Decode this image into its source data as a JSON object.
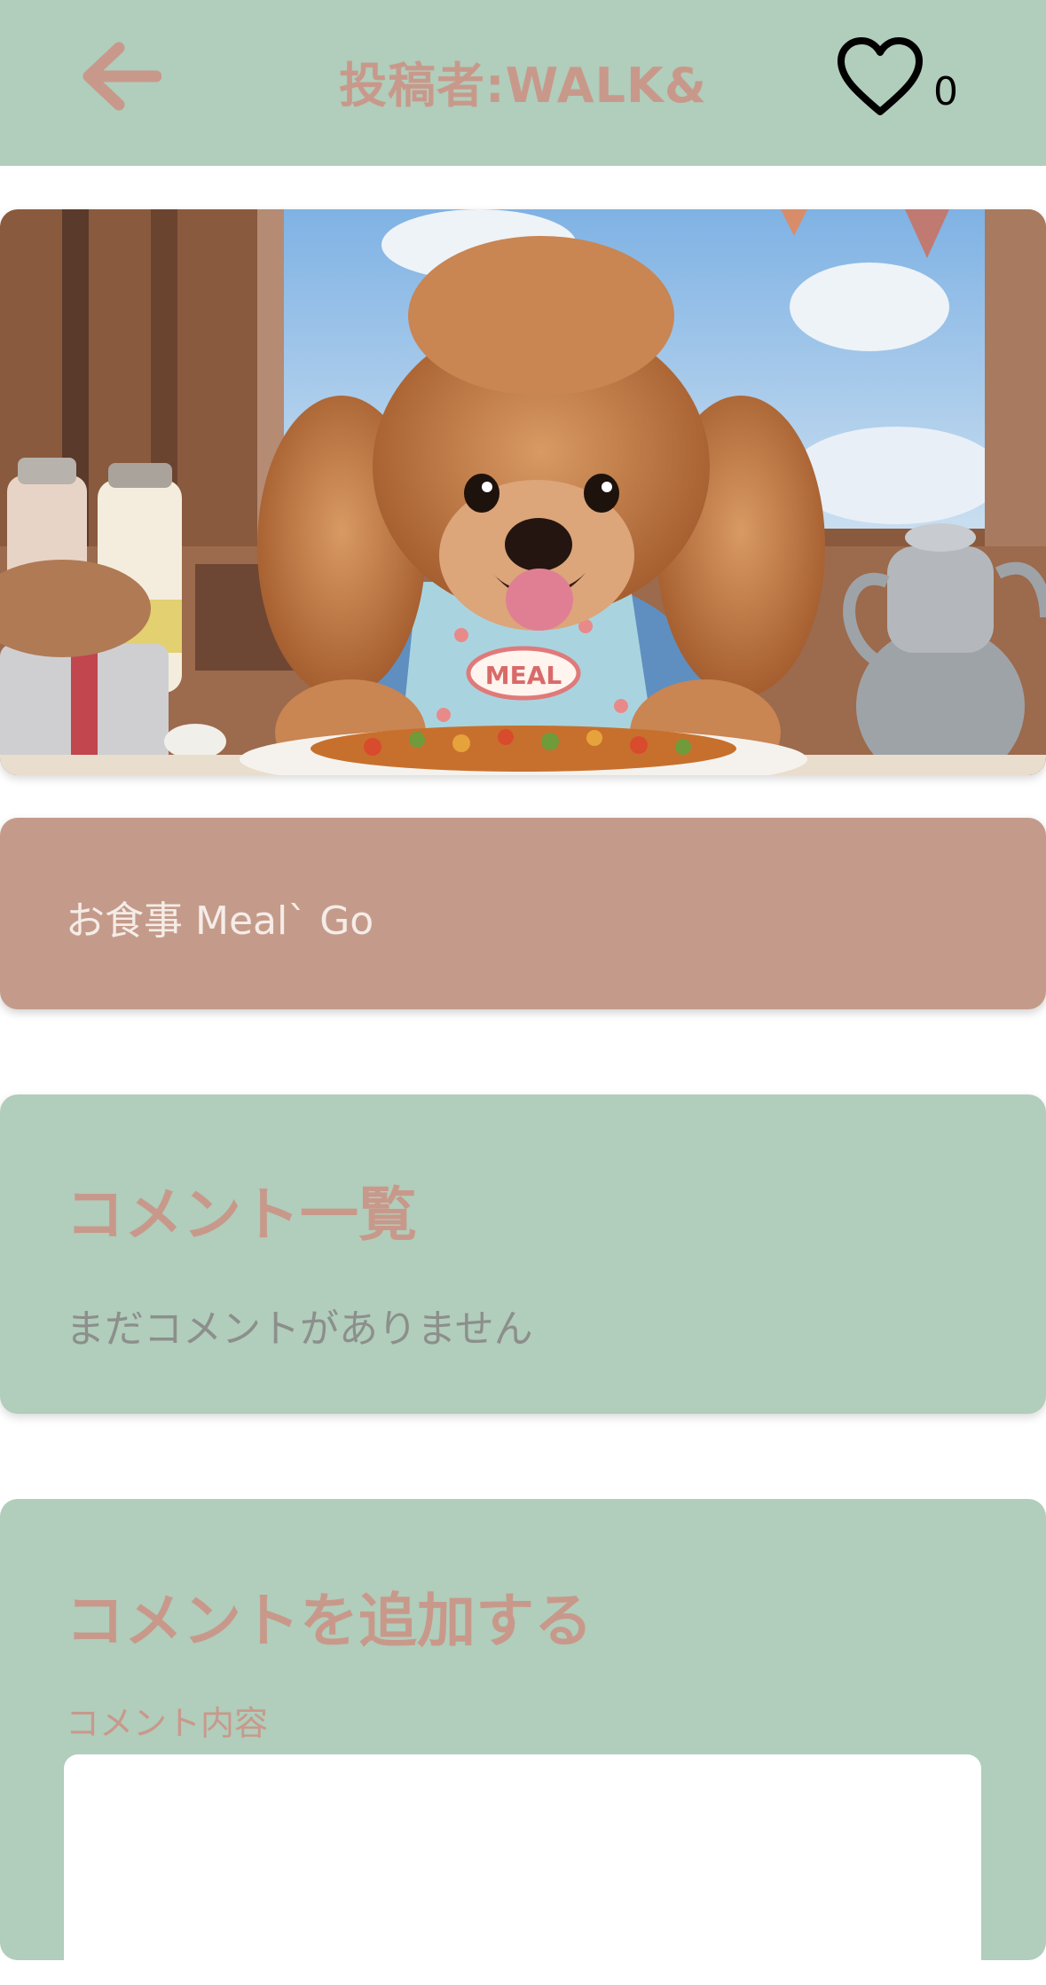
{
  "header": {
    "title": "投稿者:WALK&",
    "like_count": "0"
  },
  "post": {
    "image_label": "MEAL",
    "caption": "お食事 Meal` Go"
  },
  "comments": {
    "title": "コメント一覧",
    "empty_text": "まだコメントがありません"
  },
  "add_comment": {
    "title": "コメントを追加する",
    "field_label": "コメント内容",
    "input_value": ""
  },
  "colors": {
    "header_bg": "#b1cdbb",
    "accent": "#c8998b",
    "caption_bg": "#c49b8a"
  },
  "icons": {
    "back": "arrow-left-icon",
    "like": "heart-outline-icon"
  }
}
